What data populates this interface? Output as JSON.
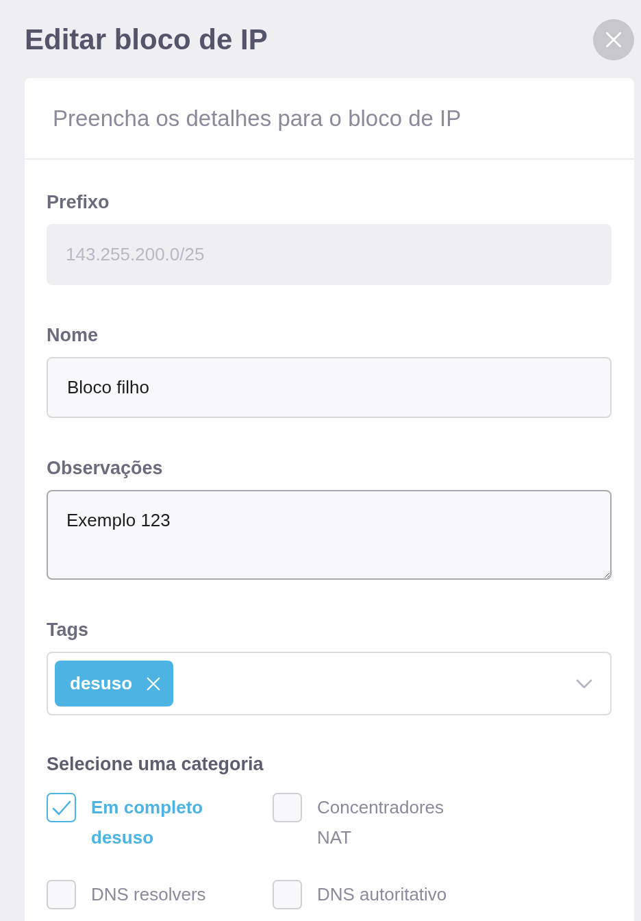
{
  "dialog": {
    "title": "Editar bloco de IP"
  },
  "form": {
    "subtitle": "Preencha os detalhes para o bloco de IP",
    "fields": [
      {
        "kind": "text",
        "label": "Prefixo",
        "value": "143.255.200.0/25",
        "disabled": true
      },
      {
        "kind": "text",
        "label": "Nome",
        "value": "Bloco filho",
        "disabled": false
      },
      {
        "kind": "textarea",
        "label": "Observações",
        "value": "Exemplo 123"
      },
      {
        "kind": "tags",
        "label": "Tags",
        "tags": [
          {
            "label": "desuso"
          }
        ]
      }
    ],
    "category": {
      "label": "Selecione uma categoria",
      "options": [
        {
          "label": "Em completo desuso",
          "checked": true
        },
        {
          "label": "Concentradores NAT",
          "checked": false
        },
        {
          "label": "DNS resolvers",
          "checked": false
        },
        {
          "label": "DNS autoritativo",
          "checked": false
        }
      ]
    }
  }
}
